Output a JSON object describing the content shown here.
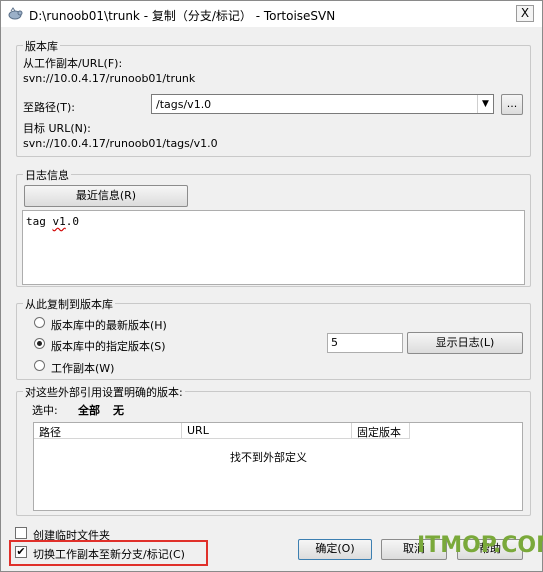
{
  "window": {
    "title": "D:\\runoob01\\trunk - 复制（分支/标记） - TortoiseSVN",
    "close_glyph": "X"
  },
  "repository": {
    "group_label": "版本库",
    "from_label": "从工作副本/URL(F):",
    "from_url": "svn://10.0.4.17/runoob01/trunk",
    "to_path_label": "至路径(T):",
    "to_path_value": "/tags/v1.0",
    "browse_label": "...",
    "target_url_label": "目标 URL(N):",
    "target_url": "svn://10.0.4.17/runoob01/tags/v1.0"
  },
  "log": {
    "group_label": "日志信息",
    "recent_button": "最近信息(R)",
    "message_prefix": "tag ",
    "message_misspelled": "v1",
    "message_suffix": ".0"
  },
  "copy_from": {
    "group_label": "从此复制到版本库",
    "options": [
      {
        "label": "版本库中的最新版本(H)",
        "selected": false
      },
      {
        "label": "版本库中的指定版本(S)",
        "selected": true
      },
      {
        "label": "工作副本(W)",
        "selected": false
      }
    ],
    "revision_value": "5",
    "show_log_button": "显示日志(L)"
  },
  "externals": {
    "group_label": "对这些外部引用设置明确的版本:",
    "select_label": "选中:",
    "select_all": "全部",
    "select_none": "无",
    "columns": [
      "路径",
      "URL",
      "固定版本"
    ],
    "empty_text": "找不到外部定义"
  },
  "options": {
    "create_intermediate_label": "创建临时文件夹",
    "create_intermediate_checked": false,
    "switch_label": "切换工作副本至新分支/标记(C)",
    "switch_checked": true
  },
  "buttons": {
    "ok": "确定(O)",
    "cancel": "取消",
    "help": "帮助"
  },
  "watermark": "ITMOP.COM",
  "colors": {
    "highlight": "#e0302a",
    "watermark": "#7aa93a",
    "spellcheck": "#d00000"
  }
}
